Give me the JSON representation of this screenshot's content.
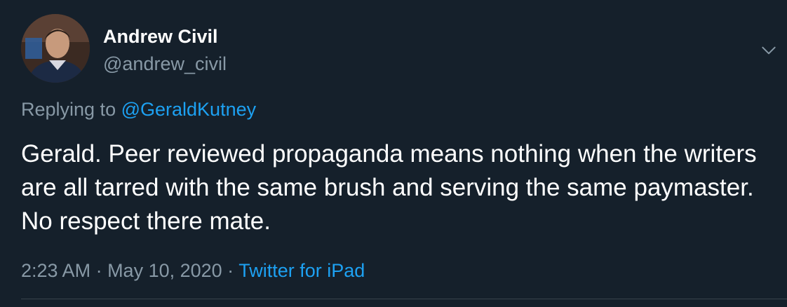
{
  "author": {
    "display_name": "Andrew Civil",
    "handle": "@andrew_civil"
  },
  "reply": {
    "prefix": "Replying to ",
    "mention": "@GeraldKutney"
  },
  "tweet": {
    "text": "Gerald. Peer reviewed propaganda means nothing when the writers are all tarred with the same brush and serving the same paymaster. No respect there mate."
  },
  "meta": {
    "time": "2:23 AM",
    "separator": " · ",
    "date": "May 10, 2020",
    "source": "Twitter for iPad"
  },
  "icons": {
    "more": "chevron-down-icon"
  },
  "colors": {
    "background": "#15202b",
    "primary_text": "#ffffff",
    "secondary_text": "#8899a6",
    "accent": "#1da1f2",
    "divider": "#38444d"
  }
}
